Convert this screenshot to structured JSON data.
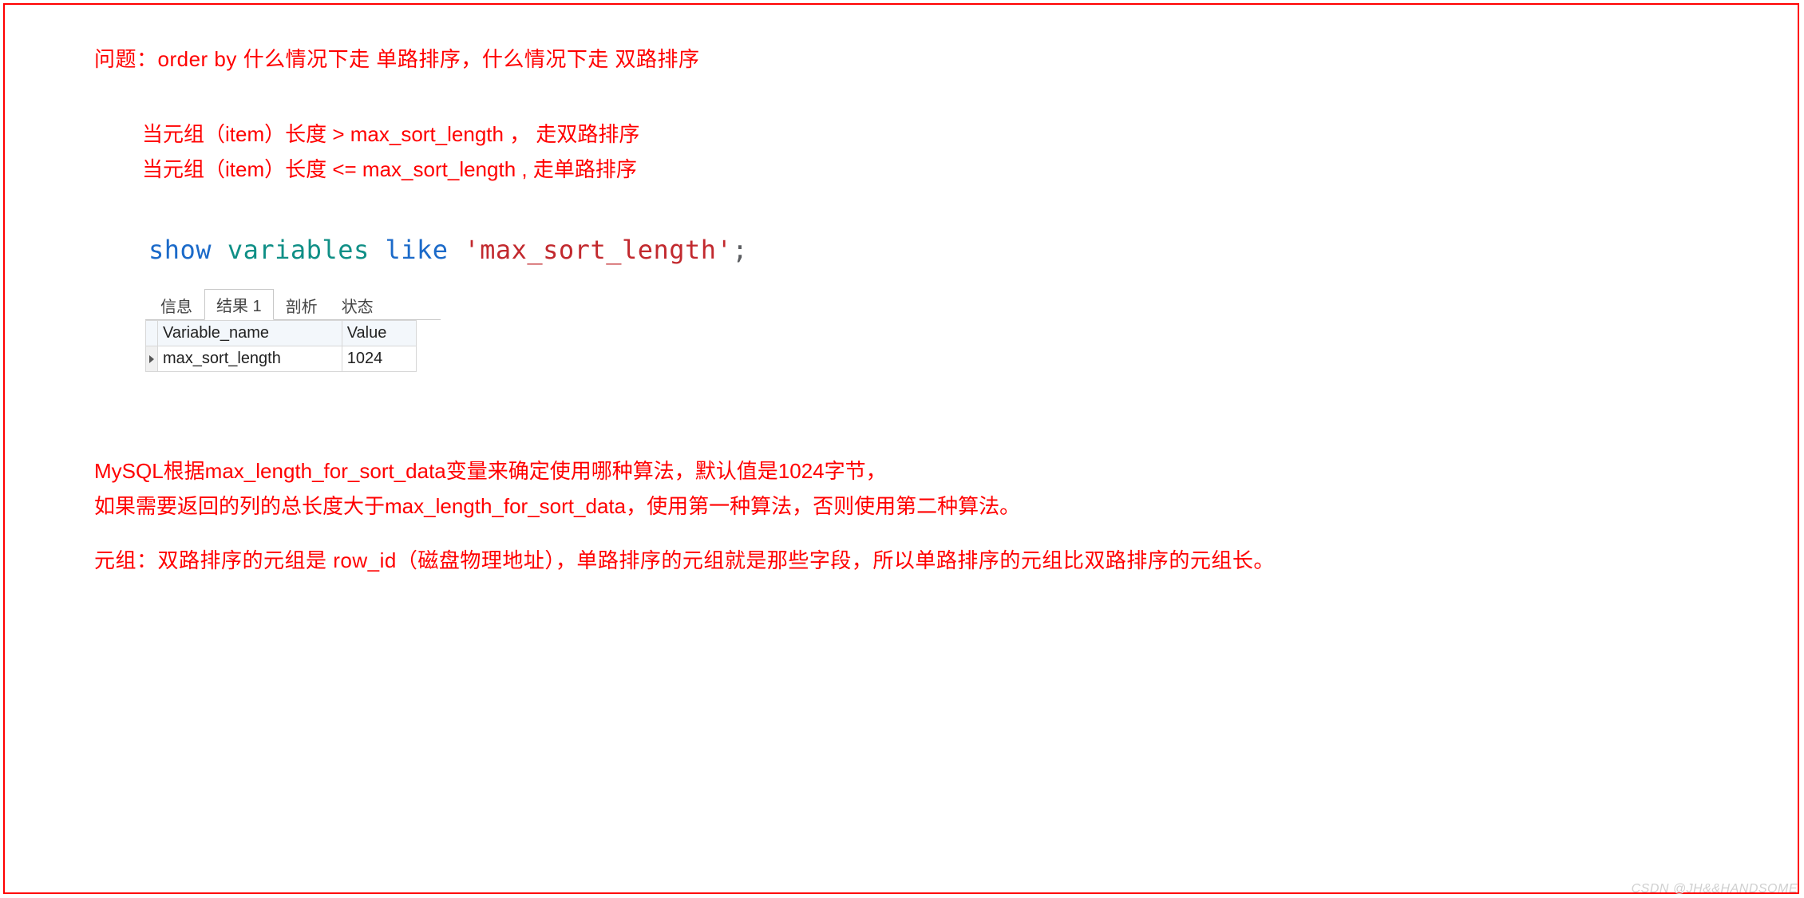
{
  "question": "问题：order by 什么情况下走 单路排序，什么情况下走 双路排序",
  "rules": {
    "line1": "当元组（item）长度 > max_sort_length ， 走双路排序",
    "line2": "当元组（item）长度 <= max_sort_length , 走单路排序"
  },
  "sql": {
    "kw_show": "show",
    "kw_variables": "variables",
    "kw_like": "like",
    "literal": "'max_sort_length'",
    "semicolon": ";"
  },
  "tabs": {
    "info": "信息",
    "result": "结果 1",
    "analyze": "剖析",
    "status": "状态"
  },
  "table": {
    "headers": {
      "variable": "Variable_name",
      "value": "Value"
    },
    "rows": [
      {
        "variable": "max_sort_length",
        "value": "1024"
      }
    ]
  },
  "explain": {
    "line1": "MySQL根据max_length_for_sort_data变量来确定使用哪种算法，默认值是1024字节，",
    "line2": "如果需要返回的列的总长度大于max_length_for_sort_data，使用第一种算法，否则使用第二种算法。"
  },
  "tuple_note": "元组：双路排序的元组是 row_id（磁盘物理地址），单路排序的元组就是那些字段，所以单路排序的元组比双路排序的元组长。",
  "watermark": "CSDN @JH&&HANDSOME"
}
